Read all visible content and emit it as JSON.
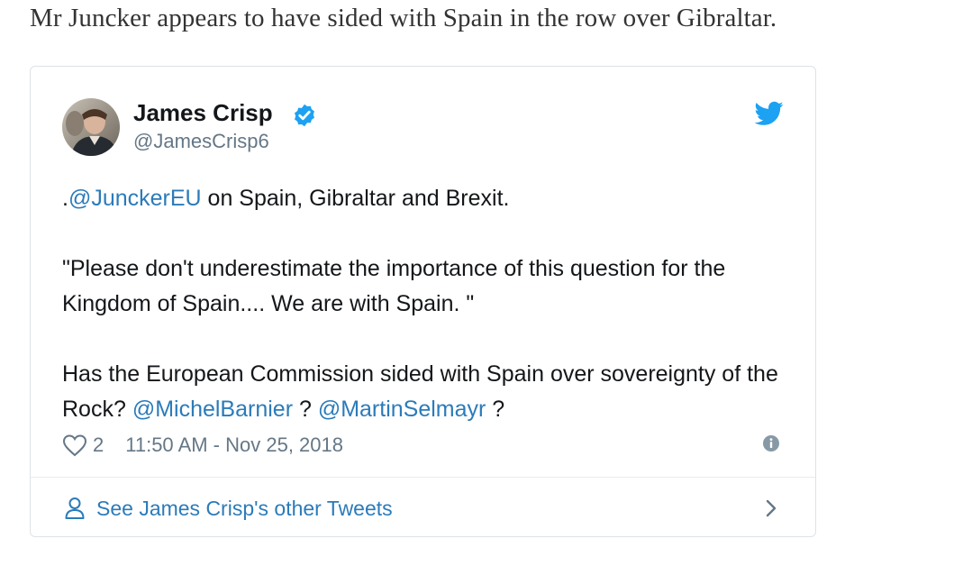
{
  "article": {
    "text": "Mr Juncker appears to have sided with Spain in the row over Gibraltar."
  },
  "tweet": {
    "author_name": "James Crisp",
    "author_handle": "@JamesCrisp6",
    "verified_icon": "verified-badge-icon",
    "brand_icon": "twitter-bird-icon",
    "brand_color": "#1da1f2",
    "link_color": "#2b7bb9",
    "paragraphs": [
      [
        {
          "text": ".",
          "mention": false
        },
        {
          "text": "@JunckerEU",
          "mention": true
        },
        {
          "text": " on Spain, Gibraltar and Brexit.",
          "mention": false
        }
      ],
      [
        {
          "text": "\"Please don't underestimate the importance of this question for the Kingdom of Spain.... We are with Spain. \"",
          "mention": false
        }
      ],
      [
        {
          "text": "Has the European Commission sided with Spain over sovereignty of the Rock? ",
          "mention": false
        },
        {
          "text": "@MichelBarnier",
          "mention": true
        },
        {
          "text": " ? ",
          "mention": false
        },
        {
          "text": "@MartinSelmayr",
          "mention": true
        },
        {
          "text": " ?",
          "mention": false
        }
      ]
    ],
    "like_count": "2",
    "timestamp": "11:50 AM - Nov 25, 2018",
    "footer_link": "See James Crisp's other Tweets"
  }
}
